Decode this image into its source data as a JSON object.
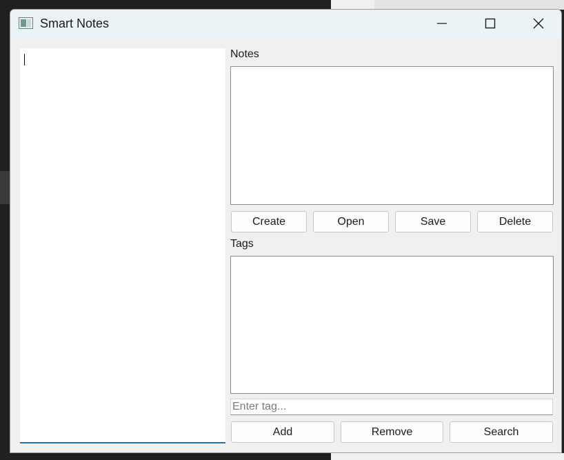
{
  "window": {
    "title": "Smart Notes"
  },
  "editor": {
    "text": ""
  },
  "notes": {
    "label": "Notes",
    "items": [],
    "buttons": {
      "create": "Create",
      "open": "Open",
      "save": "Save",
      "delete": "Delete"
    }
  },
  "tags": {
    "label": "Tags",
    "items": [],
    "input_placeholder": "Enter tag...",
    "buttons": {
      "add": "Add",
      "remove": "Remove",
      "search": "Search"
    }
  },
  "icons": {
    "app": "app-window-icon",
    "minimize": "minimize-icon",
    "maximize": "maximize-icon",
    "close": "close-icon"
  }
}
